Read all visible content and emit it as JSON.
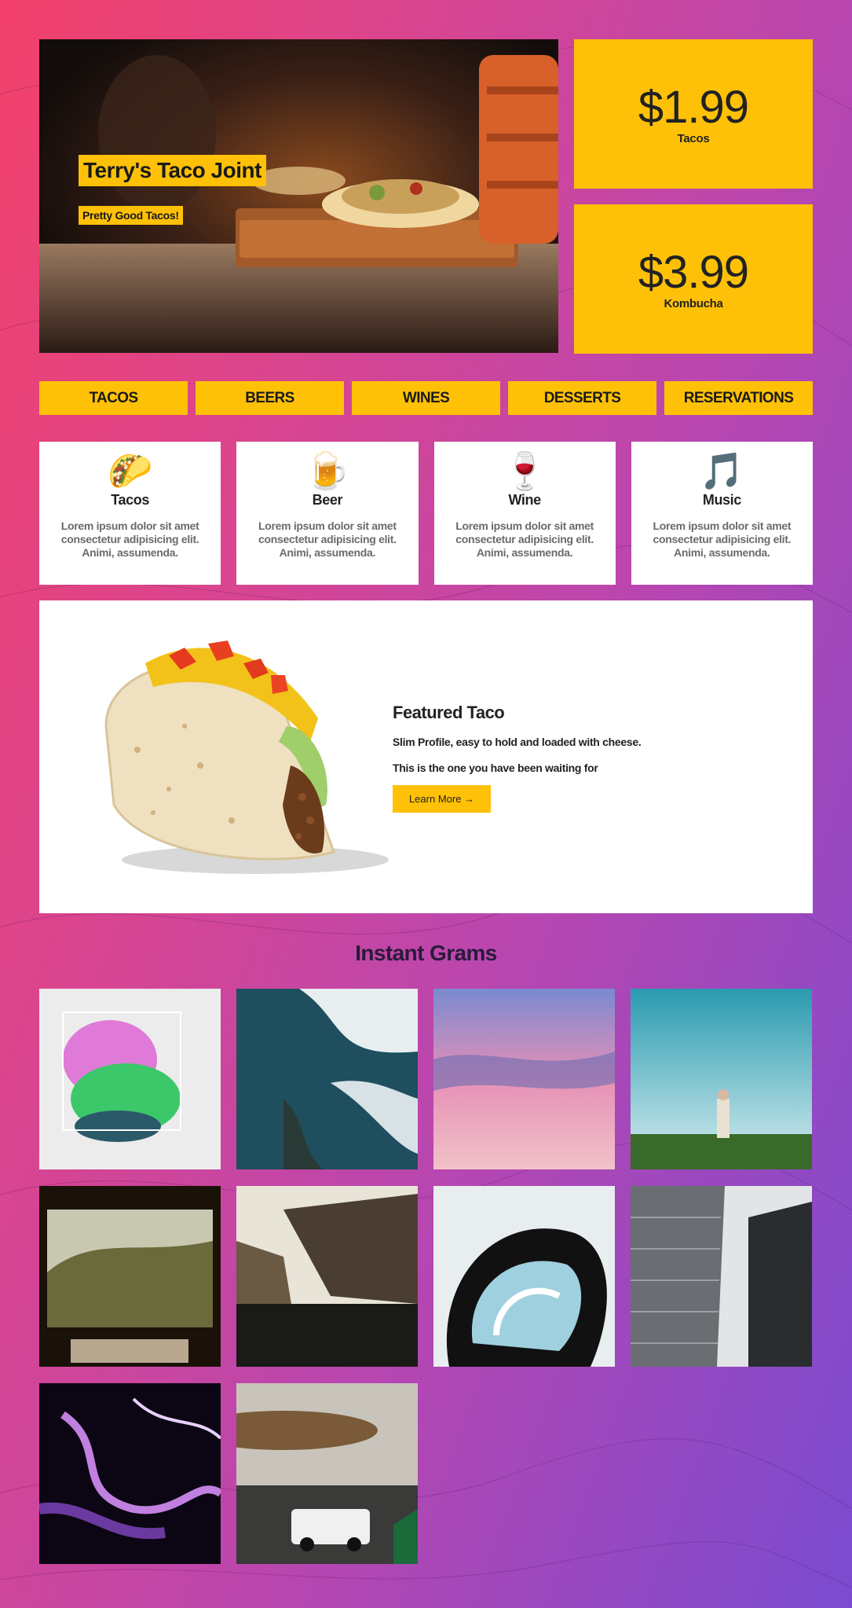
{
  "hero": {
    "title": "Terry's Taco Joint",
    "subtitle": "Pretty Good Tacos!"
  },
  "prices": [
    {
      "amount": "$1.99",
      "label": "Tacos"
    },
    {
      "amount": "$3.99",
      "label": "Kombucha"
    }
  ],
  "nav": [
    "TACOS",
    "BEERS",
    "WINES",
    "DESSERTS",
    "RESERVATIONS"
  ],
  "cards": [
    {
      "icon": "🌮",
      "icon_name": "taco-icon",
      "title": "Tacos",
      "text": "Lorem ipsum dolor sit amet consectetur adipisicing elit. Animi, assumenda."
    },
    {
      "icon": "🍺",
      "icon_name": "beer-icon",
      "title": "Beer",
      "text": "Lorem ipsum dolor sit amet consectetur adipisicing elit. Animi, assumenda."
    },
    {
      "icon": "🍷",
      "icon_name": "wine-icon",
      "title": "Wine",
      "text": "Lorem ipsum dolor sit amet consectetur adipisicing elit. Animi, assumenda."
    },
    {
      "icon": "🎵",
      "icon_name": "music-icon",
      "title": "Music",
      "text": "Lorem ipsum dolor sit amet consectetur adipisicing elit. Animi, assumenda."
    }
  ],
  "featured": {
    "title": "Featured Taco",
    "line1": "Slim Profile, easy to hold and loaded with cheese.",
    "line2": "This is the one you have been waiting for",
    "button": "Learn More →"
  },
  "grams_title": "Instant Grams",
  "colors": {
    "accent": "#ffc107",
    "background_start": "#f2406a",
    "background_end": "#7a4bd0"
  }
}
